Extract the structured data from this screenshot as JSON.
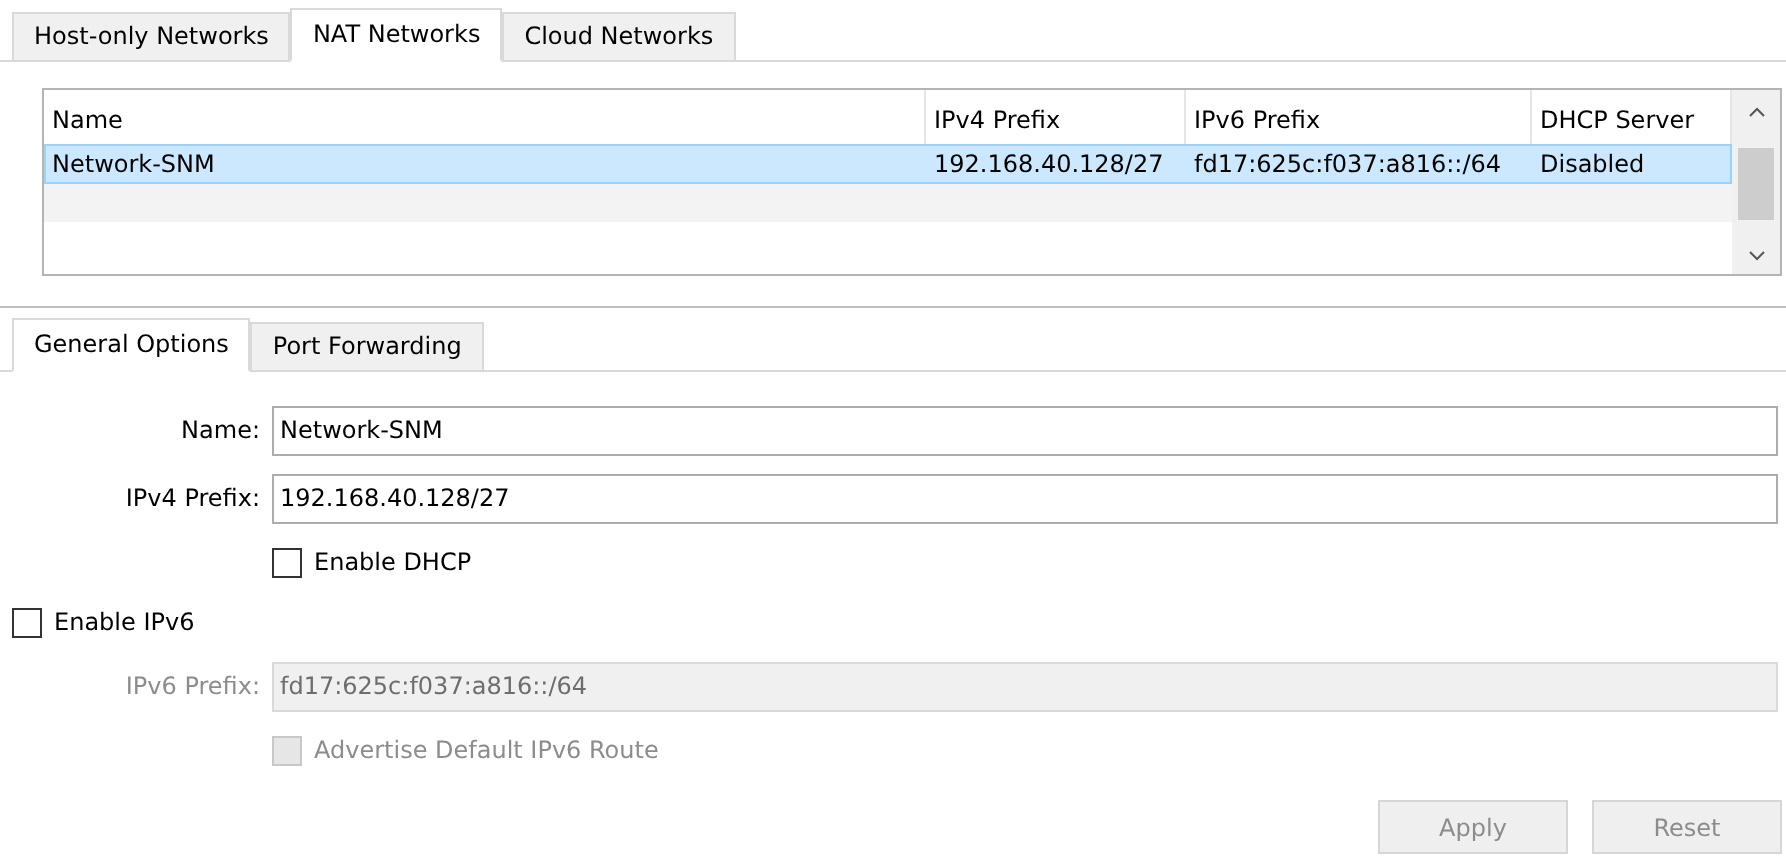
{
  "tabs": [
    {
      "label": "Host-only Networks",
      "selected": false
    },
    {
      "label": "NAT Networks",
      "selected": true
    },
    {
      "label": "Cloud Networks",
      "selected": false
    }
  ],
  "table": {
    "columns": [
      "Name",
      "IPv4 Prefix",
      "IPv6 Prefix",
      "DHCP Server"
    ],
    "rows": [
      {
        "cells": [
          "Network-SNM",
          "192.168.40.128/27",
          "fd17:625c:f037:a816::/64",
          "Disabled"
        ],
        "selected": true
      }
    ]
  },
  "detail_tabs": [
    {
      "label": "General Options",
      "selected": true
    },
    {
      "label": "Port Forwarding",
      "selected": false
    }
  ],
  "form": [
    {
      "kind": "field",
      "label": "Name:",
      "value": "Network-SNM",
      "disabled": false
    },
    {
      "kind": "field",
      "label": "IPv4 Prefix:",
      "value": "192.168.40.128/27",
      "disabled": false
    },
    {
      "kind": "check",
      "label": "Enable DHCP",
      "checked": false,
      "disabled": false,
      "indent": true
    },
    {
      "kind": "check",
      "label": "Enable IPv6",
      "checked": false,
      "disabled": false,
      "indent": false
    },
    {
      "kind": "field",
      "label": "IPv6 Prefix:",
      "value": "fd17:625c:f037:a816::/64",
      "disabled": true
    },
    {
      "kind": "check",
      "label": "Advertise Default IPv6 Route",
      "checked": false,
      "disabled": true,
      "indent": true
    }
  ],
  "buttons": [
    {
      "label": "Apply",
      "disabled": true
    },
    {
      "label": "Reset",
      "disabled": true
    }
  ]
}
